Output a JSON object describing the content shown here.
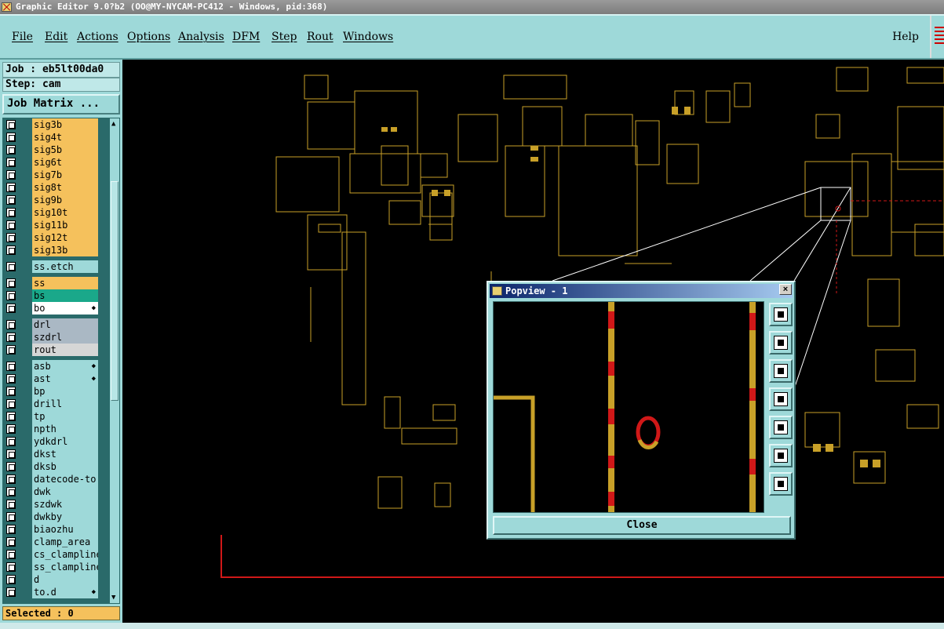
{
  "window": {
    "title": "Graphic Editor 9.0?b2 (OO@MY-NYCAM-PC412 - Windows, pid:368)"
  },
  "menu": {
    "items": [
      "File",
      "Edit",
      "Actions",
      "Options",
      "Analysis",
      "DFM",
      "Step",
      "Rout",
      "Windows"
    ],
    "help": "Help"
  },
  "panel": {
    "job_label": "Job : eb5lt00da0",
    "step_label": "Step: cam",
    "job_matrix": "Job Matrix ...",
    "selected": "Selected : 0",
    "layers": [
      {
        "name": "sig3b",
        "color": "#f5c15c"
      },
      {
        "name": "sig4t",
        "color": "#f5c15c"
      },
      {
        "name": "sig5b",
        "color": "#f5c15c"
      },
      {
        "name": "sig6t",
        "color": "#f5c15c"
      },
      {
        "name": "sig7b",
        "color": "#f5c15c"
      },
      {
        "name": "sig8t",
        "color": "#f5c15c"
      },
      {
        "name": "sig9b",
        "color": "#f5c15c"
      },
      {
        "name": "sig10t",
        "color": "#f5c15c"
      },
      {
        "name": "sig11b",
        "color": "#f5c15c"
      },
      {
        "name": "sig12t",
        "color": "#f5c15c"
      },
      {
        "name": "sig13b",
        "color": "#f5c15c"
      },
      {
        "name": "ss.etch",
        "color": "#9ed9d9"
      },
      {
        "name": "ss",
        "color": "#f5c15c"
      },
      {
        "name": "bs",
        "color": "#1aa88a"
      },
      {
        "name": "bo",
        "color": "#ffffff",
        "mark": true
      },
      {
        "name": "drl",
        "color": "#aab8c4"
      },
      {
        "name": "szdrl",
        "color": "#aab8c4"
      },
      {
        "name": "rout",
        "color": "#d6d6d6"
      },
      {
        "name": "asb",
        "color": "#9ed9d9",
        "mark": true
      },
      {
        "name": "ast",
        "color": "#9ed9d9",
        "mark": true
      },
      {
        "name": "bp",
        "color": "#9ed9d9"
      },
      {
        "name": "drill",
        "color": "#9ed9d9"
      },
      {
        "name": "tp",
        "color": "#9ed9d9"
      },
      {
        "name": "npth",
        "color": "#9ed9d9"
      },
      {
        "name": "ydkdrl",
        "color": "#9ed9d9"
      },
      {
        "name": "dkst",
        "color": "#9ed9d9"
      },
      {
        "name": "dksb",
        "color": "#9ed9d9"
      },
      {
        "name": "datecode-to",
        "color": "#9ed9d9"
      },
      {
        "name": "dwk",
        "color": "#9ed9d9"
      },
      {
        "name": "szdwk",
        "color": "#9ed9d9"
      },
      {
        "name": "dwkby",
        "color": "#9ed9d9"
      },
      {
        "name": "biaozhu",
        "color": "#9ed9d9"
      },
      {
        "name": "clamp_area",
        "color": "#9ed9d9"
      },
      {
        "name": "cs_clampline",
        "color": "#9ed9d9"
      },
      {
        "name": "ss_clampline",
        "color": "#9ed9d9"
      },
      {
        "name": "d",
        "color": "#9ed9d9"
      },
      {
        "name": "to.d",
        "color": "#9ed9d9",
        "mark": true
      }
    ]
  },
  "popview": {
    "title": "Popview - 1",
    "close_label": "Close",
    "close_x": "×",
    "tools": [
      "zoom-fit-icon",
      "pan-up-icon",
      "pan-down-icon",
      "pan-left-icon",
      "pan-right-icon",
      "zoom-out-icon",
      "zoom-in-icon"
    ]
  },
  "colors": {
    "panel_bg": "#9ed9d9",
    "trace": "#c8a028",
    "outline_red": "#d01818"
  }
}
